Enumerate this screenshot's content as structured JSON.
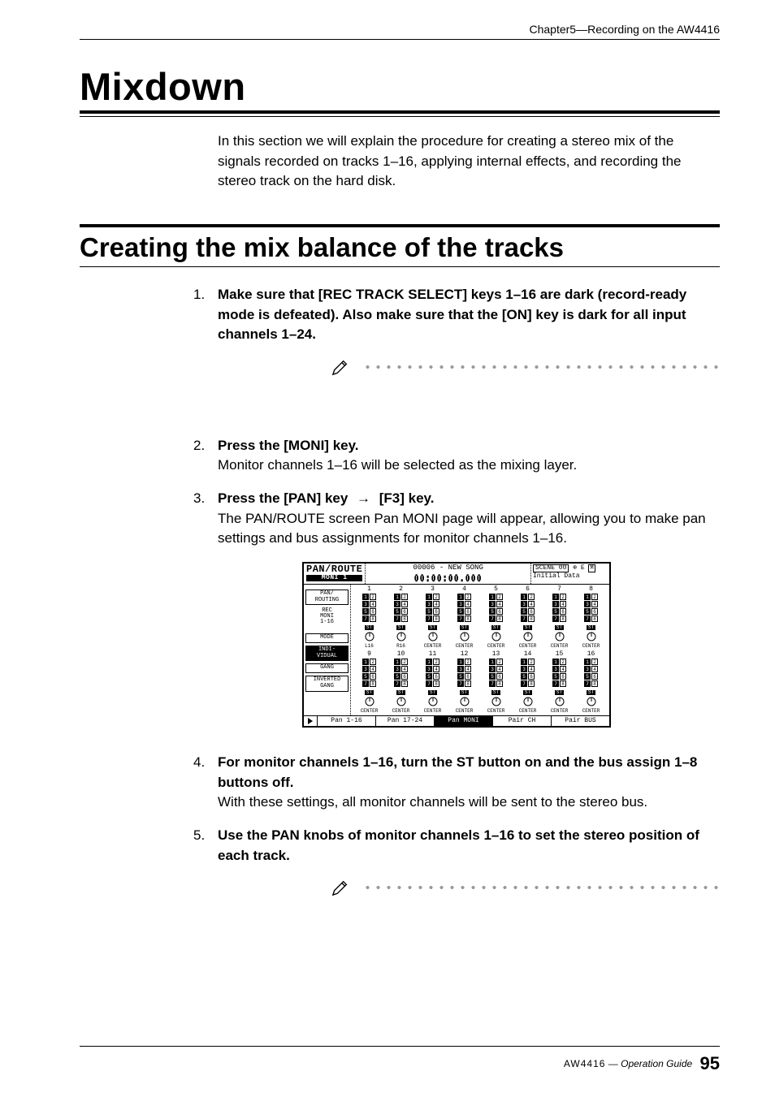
{
  "running_head": "Chapter5—Recording on the AW4416",
  "h1": "Mixdown",
  "intro": "In this section we will explain the procedure for creating a stereo mix of the signals recorded on tracks 1–16, applying internal effects, and recording the stereo track on the hard disk.",
  "h2": "Creating the mix balance of the tracks",
  "steps": [
    {
      "num": "1.",
      "title": "Make sure that [REC TRACK SELECT] keys 1–16 are dark (record-ready mode is defeated). Also make sure that the [ON] key is dark for all input channels 1–24.",
      "detail": ""
    },
    {
      "num": "2.",
      "title": "Press the [MONI] key.",
      "detail": "Monitor channels 1–16 will be selected as the mixing layer."
    },
    {
      "num": "3.",
      "title_parts": [
        "Press the [PAN] key ",
        " [F3] key."
      ],
      "detail": "The PAN/ROUTE screen Pan MONI page will appear, allowing you to make pan settings and bus assignments for monitor channels 1–16."
    },
    {
      "num": "4.",
      "title": "For monitor channels 1–16, turn the ST button on and the bus assign 1–8 buttons off.",
      "detail": "With these settings, all monitor channels will be sent to the stereo bus."
    },
    {
      "num": "5.",
      "title": "Use the PAN knobs of monitor channels 1–16 to set the stereo position of each track.",
      "detail": ""
    }
  ],
  "screenshot": {
    "screen_title": "PAN/ROUTE",
    "screen_sub": "MONI 1",
    "song_line": "00006 - NEW SONG",
    "timecode": "00:00:00.000",
    "scene": "SCENE 00",
    "data_label": "Initial Data",
    "icons_right": "⊕ E",
    "m_badge": "M",
    "side": {
      "box1_l1": "PAN/",
      "box1_l2": "ROUTING",
      "label1_l1": "REC",
      "label1_l2": "MONI",
      "label1_l3": "1-16",
      "mode_label": "MODE",
      "box2_l1": "INDI-",
      "box2_l2": "VIDUAL",
      "box3": "GANG",
      "box4_l1": "INVERTED",
      "box4_l2": "GANG"
    },
    "row_a_headers": [
      "1",
      "2",
      "3",
      "4",
      "5",
      "6",
      "7",
      "8"
    ],
    "row_b_headers": [
      "9",
      "10",
      "11",
      "12",
      "13",
      "14",
      "15",
      "16"
    ],
    "bus_rows": [
      [
        "1",
        "2"
      ],
      [
        "3",
        "4"
      ],
      [
        "5",
        "6"
      ],
      [
        "7",
        "8"
      ]
    ],
    "st_label": "ST",
    "pan_positions_a": [
      "L16",
      "R16",
      "CENTER",
      "CENTER",
      "CENTER",
      "CENTER",
      "CENTER",
      "CENTER"
    ],
    "pan_positions_b": [
      "CENTER",
      "CENTER",
      "CENTER",
      "CENTER",
      "CENTER",
      "CENTER",
      "CENTER",
      "CENTER"
    ],
    "tabs": [
      "Pan 1-16",
      "Pan 17-24",
      "Pan MONI",
      "Pair CH",
      "Pair BUS"
    ],
    "active_tab_index": 2
  },
  "footer": {
    "model": "AW4416",
    "guide": "— Operation Guide",
    "page": "95"
  }
}
